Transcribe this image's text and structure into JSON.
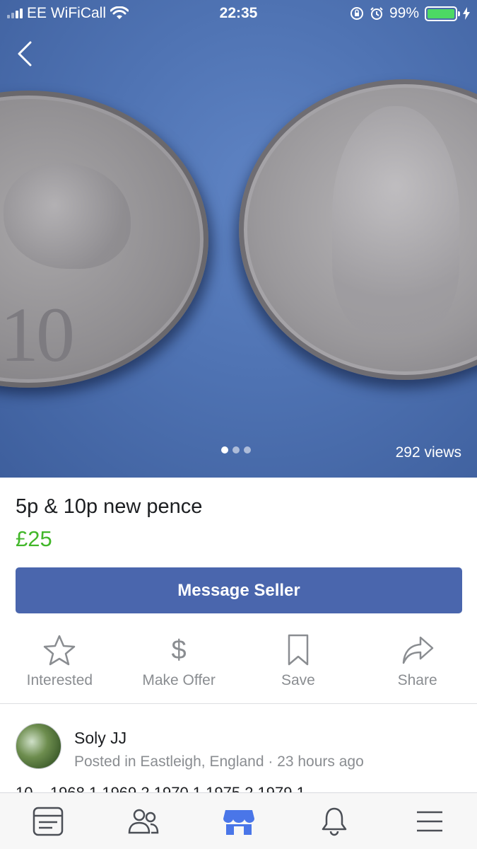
{
  "status_bar": {
    "carrier": "EE WiFiCall",
    "time": "22:35",
    "battery_percent": "99%",
    "battery_level": 0.99
  },
  "photo": {
    "views": "292 views",
    "page_count": 3,
    "current_page": 1,
    "background_color": "#4f73b3"
  },
  "listing": {
    "title": "5p & 10p new pence",
    "price": "£25",
    "price_color": "#42b72a"
  },
  "message_button": {
    "label": "Message Seller",
    "color": "#4a66ad"
  },
  "actions": [
    {
      "label": "Interested",
      "icon": "star-icon"
    },
    {
      "label": "Make Offer",
      "icon": "dollar-icon"
    },
    {
      "label": "Save",
      "icon": "bookmark-icon"
    },
    {
      "label": "Share",
      "icon": "share-icon"
    }
  ],
  "seller": {
    "name": "Soly JJ",
    "meta": "Posted in Eastleigh, England · 23 hours ago"
  },
  "description_partial": "10 – 1968 1 1969 2 1970 1 1975 2 1979 1",
  "tab_bar": {
    "tabs": [
      {
        "name": "news-feed",
        "icon": "news-feed-icon"
      },
      {
        "name": "friends",
        "icon": "friends-icon"
      },
      {
        "name": "marketplace",
        "icon": "marketplace-icon",
        "active": true
      },
      {
        "name": "notifications",
        "icon": "bell-icon"
      },
      {
        "name": "menu",
        "icon": "menu-icon"
      }
    ],
    "active_color": "#4a76e8",
    "inactive_color": "#4b4f56"
  }
}
